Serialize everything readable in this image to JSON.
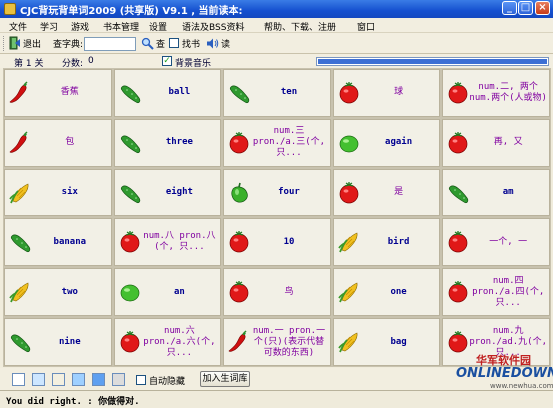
{
  "window": {
    "title": "CJC背玩背单词2009 (共享版) V9.1 , 当前读本:"
  },
  "menu": [
    "文件",
    "学习",
    "游戏",
    "书本管理",
    "设置",
    "语法及BSS资料",
    "帮助、下载、注册",
    "窗口"
  ],
  "toolbar": {
    "exit_label": "退出",
    "search_label": "查字典:",
    "search_value": "",
    "lookup_label": "查",
    "find_book_label": "找书",
    "read_label": "读"
  },
  "info": {
    "level": "第 1 关",
    "score_label": "分数:",
    "score_value": "0",
    "music_label": "背景音乐",
    "music_checked": true,
    "progress": 1.0
  },
  "cards": [
    {
      "veg": "chili",
      "text": "香蕉",
      "zh": true
    },
    {
      "veg": "cucumber",
      "text": "ball",
      "zh": false
    },
    {
      "veg": "cucumber",
      "text": "ten",
      "zh": false
    },
    {
      "veg": "tomato",
      "text": "球",
      "zh": true
    },
    {
      "veg": "tomato",
      "text": "num.二, 两个num.两个(人或物)",
      "zh": true
    },
    {
      "veg": "chili",
      "text": "包",
      "zh": true
    },
    {
      "veg": "cucumber",
      "text": "three",
      "zh": false
    },
    {
      "veg": "tomato",
      "text": "num.三 pron./a.三(个, 只...",
      "zh": true
    },
    {
      "veg": "lime",
      "text": "again",
      "zh": false
    },
    {
      "veg": "tomato",
      "text": "再, 又",
      "zh": true
    },
    {
      "veg": "corn",
      "text": "six",
      "zh": false
    },
    {
      "veg": "cucumber",
      "text": "eight",
      "zh": false
    },
    {
      "veg": "pepper",
      "text": "four",
      "zh": false
    },
    {
      "veg": "tomato",
      "text": "是",
      "zh": true
    },
    {
      "veg": "cucumber",
      "text": "am",
      "zh": false
    },
    {
      "veg": "cucumber",
      "text": "banana",
      "zh": false
    },
    {
      "veg": "tomato",
      "text": "num.八 pron.八(个, 只...",
      "zh": true
    },
    {
      "veg": "tomato",
      "text": "10",
      "zh": false
    },
    {
      "veg": "corn",
      "text": "bird",
      "zh": false
    },
    {
      "veg": "tomato",
      "text": "一个, 一",
      "zh": true
    },
    {
      "veg": "corn",
      "text": "two",
      "zh": false
    },
    {
      "veg": "lime",
      "text": "an",
      "zh": false
    },
    {
      "veg": "tomato",
      "text": "鸟",
      "zh": true
    },
    {
      "veg": "corn",
      "text": "one",
      "zh": false
    },
    {
      "veg": "tomato",
      "text": "num.四 pron./a.四(个, 只...",
      "zh": true
    },
    {
      "veg": "cucumber",
      "text": "nine",
      "zh": false
    },
    {
      "veg": "tomato",
      "text": "num.六 pron./a.六(个, 只...",
      "zh": true
    },
    {
      "veg": "chili",
      "text": "num.一 pron.一个(只)(表示代替可数的东西)",
      "zh": true
    },
    {
      "veg": "corn",
      "text": "bag",
      "zh": false
    },
    {
      "veg": "tomato",
      "text": "num.九 pron./ad.九(个, 只...",
      "zh": true
    }
  ],
  "bottom": {
    "auto_hide_label": "自动隐藏",
    "add_button_label": "加入生词库"
  },
  "watermark": {
    "cn": "华军软件园",
    "en": "ONLINEDOWN",
    "url": "www.newhua.com"
  },
  "status": {
    "text": "You did right. : 你做得对."
  },
  "colors": {
    "title_bar": "#1550cf",
    "card_bg": "#f2f0e6",
    "english_text": "#000090",
    "chinese_text": "#8000a0"
  }
}
